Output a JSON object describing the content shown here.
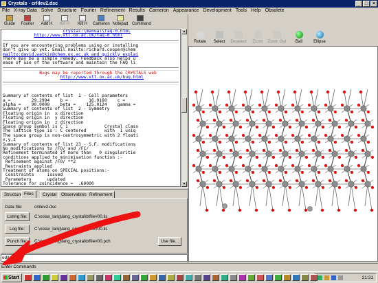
{
  "window": {
    "title": "Crystals - crlilev2.dsc"
  },
  "menu": [
    "File",
    "X-ray Data",
    "Solve",
    "Structure",
    "Fourier",
    "Refinement",
    "Results",
    "Cameron",
    "Appearance",
    "Development",
    "Tools",
    "Help",
    "Obsolete"
  ],
  "toolbar": [
    {
      "label": "Guide",
      "icon": "book-icon",
      "enabled": true
    },
    {
      "label": "Fourier",
      "icon": "fourier-icon",
      "enabled": true
    },
    {
      "label": "Add H",
      "icon": "add-hydrogen-icon",
      "enabled": true
    },
    {
      "label": "Kill H",
      "icon": "kill-hydrogen-icon",
      "enabled": false
    },
    {
      "label": "Kill H",
      "icon": "kill-hydrogen-icon",
      "enabled": true
    },
    {
      "label": "Cameron",
      "icon": "cameron-icon",
      "enabled": true
    },
    {
      "label": "Notepad",
      "icon": "notepad-icon",
      "enabled": true
    },
    {
      "label": "Command",
      "icon": "command-icon",
      "enabled": true
    }
  ],
  "text_output": {
    "lines": [
      {
        "t": "crystal:\\manual\\faq-0.html",
        "c": "link",
        "i": 23
      },
      {
        "t": "http://www.xtl.ox.ac.uk/faq-0.html",
        "c": "link",
        "i": 12
      },
      {
        "t": "",
        "c": "rule"
      },
      {
        "t": "If you are encountering problems using or installing",
        "c": "",
        "i": 0
      },
      {
        "t": "don't give up yet. Email mailto:richard.cooper@chem",
        "c": "",
        "i": 0
      },
      {
        "t": "mailto:david.watkin@chem.ox.ac.uk and quickly explai",
        "c": "link",
        "i": 0
      },
      {
        "t": "There may be a simple remedy. Feedback also helps u",
        "c": "",
        "i": 0
      },
      {
        "t": "ease of use of the software and maintain the FAQ li",
        "c": "",
        "i": 0
      },
      {
        "t": "",
        "c": "rule"
      },
      {
        "t": "Bugs may be reported through the CRYSTALS web",
        "c": "red",
        "i": 14
      },
      {
        "t": "http://www.xtl.ox.ac.uk/bug.html",
        "c": "link",
        "i": 22
      },
      {
        "t": "",
        "c": "rule"
      },
      {
        "t": "",
        "c": ""
      },
      {
        "t": "",
        "c": ""
      },
      {
        "t": "Summary of contents of list  1 - Cell parameters",
        "c": "",
        "i": 0
      },
      {
        "t": "a =        29.2994    b =        16.9160    c =",
        "c": "",
        "i": 0
      },
      {
        "t": "alpha =    90.0000    beta =    125.0124    gamma =",
        "c": "",
        "i": 0
      },
      {
        "t": "Summary of contents of list  2 - Symmetry",
        "c": "",
        "i": 0
      },
      {
        "t": "Floating origin in  x direction",
        "c": "",
        "i": 0
      },
      {
        "t": "Floating origin in  y direction",
        "c": "",
        "i": 0
      },
      {
        "t": "Floating origin in  z direction",
        "c": "",
        "i": 0
      },
      {
        "t": "Space group symbol is C 1              Crystal class",
        "c": "",
        "i": 0
      },
      {
        "t": "The lattice type is : C centered       with  1 uniq",
        "c": "",
        "i": 0
      },
      {
        "t": "The space group is non-centrosymmetric with 2 floati",
        "c": "",
        "i": 0
      },
      {
        "t": "x,y,z",
        "c": "",
        "i": 0
      },
      {
        "t": "Summary of contents of list 23 - S.F. modifications",
        "c": "",
        "i": 0
      },
      {
        "t": "No modifications to /FO/ and /FC/",
        "c": "",
        "i": 0
      },
      {
        "t": "Refinement terminated if more than   0 singularitie",
        "c": "",
        "i": 0
      },
      {
        "t": "conditions applied to minimisation function :-",
        "c": "",
        "i": 0
      },
      {
        "t": " Refinement against /FO/ **2",
        "c": "",
        "i": 0
      },
      {
        "t": " Restraints applied",
        "c": "",
        "i": 0
      },
      {
        "t": "Treatment of atoms on SPECIAL positions:-",
        "c": "",
        "i": 0
      },
      {
        "t": " Constraints     issued",
        "c": "",
        "i": 0
      },
      {
        "t": " Parameters      updated",
        "c": "",
        "i": 0
      },
      {
        "t": "Tolerance for coincidence =  .60000",
        "c": "",
        "i": 0
      }
    ]
  },
  "tabs": [
    "Structure",
    "Files",
    "Crystal",
    "Observations",
    "Refinement"
  ],
  "active_tab": "Files",
  "files": {
    "data_file_label": "Data file:",
    "data_file_value": "crlilev2.dsc",
    "listing_button": "Listing file:",
    "listing_path": "C:\\xolax_lang\\lang_crystal\\blfile#00.lis",
    "log_button": "Log file:",
    "log_path": "C:\\xolax_lang\\lang_crystal\\blfile#00.lis",
    "punch_button": "Punch file:",
    "punch_path": "C:\\xolax_lang\\lang_crystal\\blfile#00.pch",
    "use_file_button": "Use file..."
  },
  "command": {
    "value": "edit"
  },
  "status": {
    "text": "Enter Commands"
  },
  "model_toolbar": [
    {
      "label": "Rotate",
      "icon": "rotate-icon",
      "enabled": true
    },
    {
      "label": "Select",
      "icon": "select-icon",
      "enabled": true
    },
    {
      "label": "Deselect",
      "icon": "deselect-icon",
      "enabled": false
    },
    {
      "label": "Zoom",
      "icon": "zoom-icon",
      "enabled": false
    },
    {
      "label": "Zoom Out",
      "icon": "zoom-out-icon",
      "enabled": false
    },
    {
      "label": "Ball",
      "icon": "ball-icon",
      "enabled": true
    },
    {
      "label": "Ellipse",
      "icon": "ellipse-icon",
      "enabled": true
    }
  ],
  "taskbar": {
    "start_label": "Start",
    "clock": "21:31"
  },
  "colors": {
    "titlebar": "#0a246a",
    "annotation_arrow": "#ee1111",
    "oxygen": "#dd1111",
    "metal": "#8c8c8c",
    "link": "#0000cc"
  }
}
